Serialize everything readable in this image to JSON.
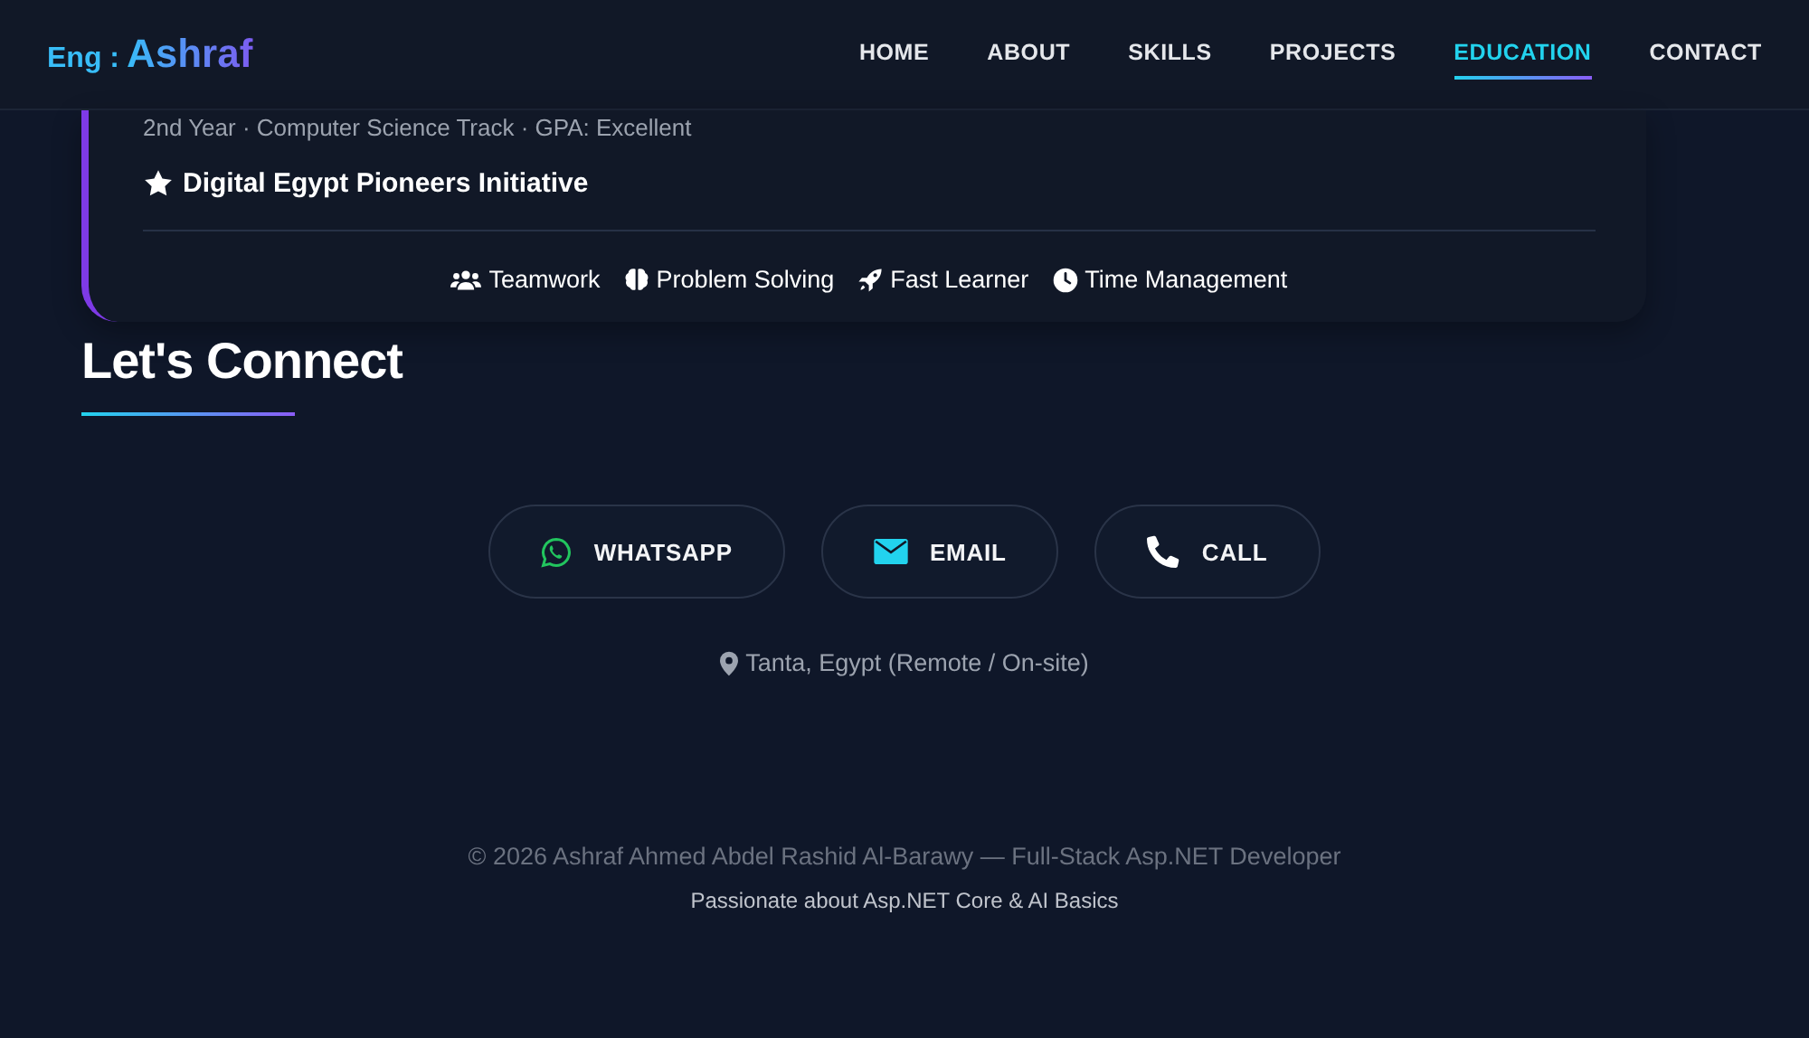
{
  "header": {
    "logo_prefix": "Eng :",
    "logo_name": "Ashraf"
  },
  "nav": [
    {
      "label": "HOME",
      "selected": false
    },
    {
      "label": "ABOUT",
      "selected": false
    },
    {
      "label": "SKILLS",
      "selected": false
    },
    {
      "label": "PROJECTS",
      "selected": false
    },
    {
      "label": "EDUCATION",
      "selected": true
    },
    {
      "label": "CONTACT",
      "selected": false
    }
  ],
  "education_card": {
    "details": "2nd Year · Computer Science Track · GPA: Excellent",
    "achievement": "Digital Egypt Pioneers Initiative",
    "skills": [
      {
        "kind": "team",
        "label": "Teamwork"
      },
      {
        "kind": "brain",
        "label": "Problem Solving"
      },
      {
        "kind": "rocket",
        "label": "Fast Learner"
      },
      {
        "kind": "clock",
        "label": "Time Management"
      }
    ]
  },
  "contact": {
    "title": "Let's Connect",
    "buttons": [
      {
        "kind": "whatsapp",
        "label": "WHATSAPP"
      },
      {
        "kind": "email",
        "label": "EMAIL"
      },
      {
        "kind": "call",
        "label": "CALL"
      }
    ],
    "location": "Tanta, Egypt (Remote / On-site)"
  },
  "footer": {
    "copyright": "© 2026 Ashraf Ahmed Abdel Rashid Al-Barawy — Full-Stack Asp.NET Developer",
    "tagline": "Passionate about Asp.NET Core & AI Basics"
  }
}
